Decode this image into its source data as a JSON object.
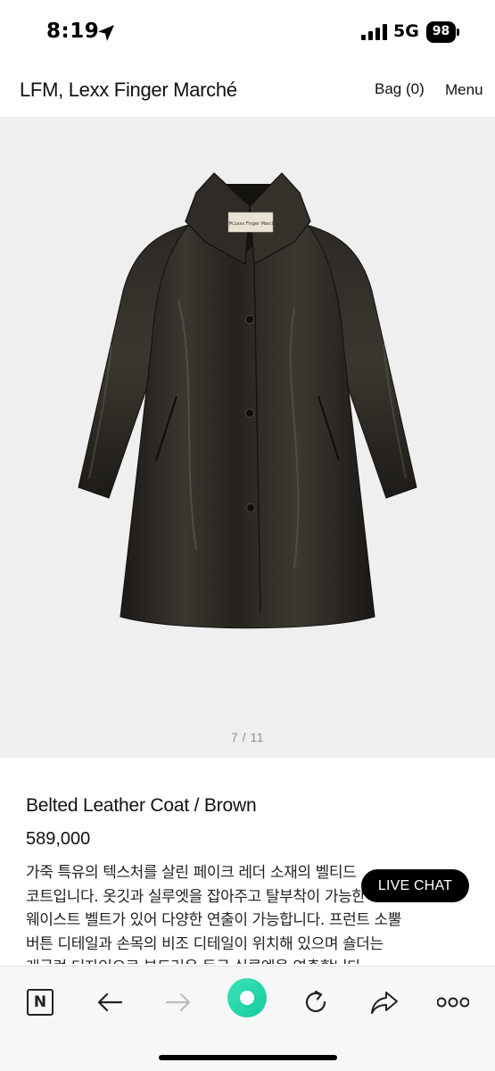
{
  "status_bar": {
    "time": "8:19",
    "network": "5G",
    "battery": "98"
  },
  "header": {
    "brand": "LFM, Lexx Finger Marché",
    "bag": "Bag (0)",
    "menu": "Menu"
  },
  "gallery": {
    "counter": "7 / 11",
    "coat_label": "LFM,Lexx Finger Marche"
  },
  "product": {
    "title": "Belted Leather Coat / Brown",
    "price": "589,000",
    "description_lines": [
      "가죽 특유의 텍스처를 살린 페이크 레더 소재의 벨티드",
      "코트입니다. 옷깃과 실루엣을 잡아주고 탈부착이 가능한",
      "웨이스트 벨트가 있어 다양한 연출이 가능합니다. 프런트 소뿔",
      "버튼 디테일과 손목의 비조 디테일이 위치해 있으며 숄더는",
      "래글런 디자인으로 부드러운 둥근 실루엣을 연출합니다."
    ]
  },
  "live_chat": "LIVE CHAT",
  "toolbar": {
    "n_label": "N",
    "icons": [
      "naver-n-icon",
      "back-arrow-icon",
      "forward-arrow-icon",
      "home-icon",
      "refresh-icon",
      "share-icon",
      "more-icon"
    ],
    "accent_color": "#1fd3a8"
  }
}
